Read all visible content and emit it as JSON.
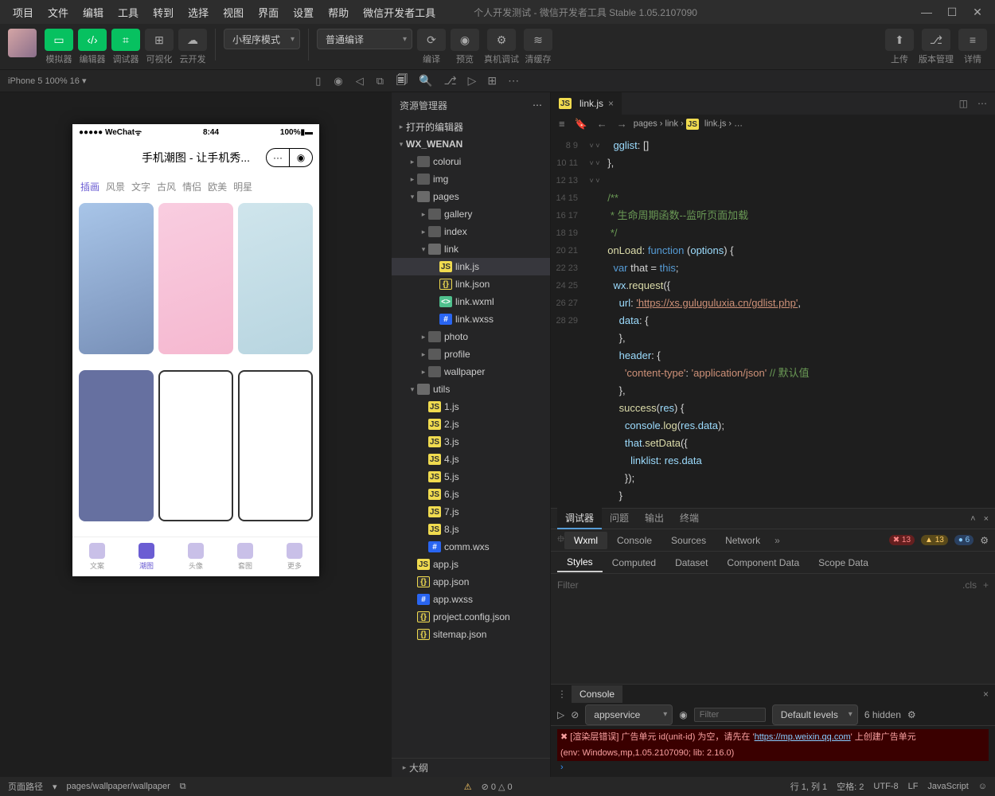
{
  "menu": [
    "项目",
    "文件",
    "编辑",
    "工具",
    "转到",
    "选择",
    "视图",
    "界面",
    "设置",
    "帮助",
    "微信开发者工具"
  ],
  "title": "个人开发测试 - 微信开发者工具 Stable 1.05.2107090",
  "toolbar": {
    "sim": "模拟器",
    "editor": "编辑器",
    "debugger": "调试器",
    "vis": "可视化",
    "cloud": "云开发",
    "mode": "小程序模式",
    "compile_mode": "普通编译",
    "compile": "编译",
    "preview": "预览",
    "remote": "真机调试",
    "clear": "清缓存",
    "upload": "上传",
    "version": "版本管理",
    "detail": "详情"
  },
  "sim": {
    "device": "iPhone 5 100% 16",
    "device_suffix": "▾"
  },
  "phone": {
    "carrier": "●●●●● WeChat",
    "wifi": "⌃",
    "time": "8:44",
    "battery": "100%",
    "title": "手机潮图 - 让手机秀...",
    "tabs": [
      "插画",
      "风景",
      "文字",
      "古风",
      "情侣",
      "欧美",
      "明星"
    ],
    "tabbar": [
      "文案",
      "潮图",
      "头像",
      "套图",
      "更多"
    ]
  },
  "explorer": {
    "title": "资源管理器",
    "sections": {
      "open_editors": "打开的编辑器",
      "project": "WX_WENAN",
      "outline": "大纲"
    },
    "tree": [
      {
        "d": 1,
        "t": "folder",
        "n": "colorui"
      },
      {
        "d": 1,
        "t": "folder-img",
        "n": "img"
      },
      {
        "d": 1,
        "t": "folder-open",
        "n": "pages",
        "open": true
      },
      {
        "d": 2,
        "t": "folder",
        "n": "gallery"
      },
      {
        "d": 2,
        "t": "folder",
        "n": "index"
      },
      {
        "d": 2,
        "t": "folder-open",
        "n": "link",
        "open": true
      },
      {
        "d": 3,
        "t": "js",
        "n": "link.js",
        "sel": true
      },
      {
        "d": 3,
        "t": "json",
        "n": "link.json"
      },
      {
        "d": 3,
        "t": "wxml",
        "n": "link.wxml"
      },
      {
        "d": 3,
        "t": "wxss",
        "n": "link.wxss"
      },
      {
        "d": 2,
        "t": "folder",
        "n": "photo"
      },
      {
        "d": 2,
        "t": "folder",
        "n": "profile"
      },
      {
        "d": 2,
        "t": "folder",
        "n": "wallpaper"
      },
      {
        "d": 1,
        "t": "folder-open",
        "n": "utils",
        "open": true
      },
      {
        "d": 2,
        "t": "js",
        "n": "1.js"
      },
      {
        "d": 2,
        "t": "js",
        "n": "2.js"
      },
      {
        "d": 2,
        "t": "js",
        "n": "3.js"
      },
      {
        "d": 2,
        "t": "js",
        "n": "4.js"
      },
      {
        "d": 2,
        "t": "js",
        "n": "5.js"
      },
      {
        "d": 2,
        "t": "js",
        "n": "6.js"
      },
      {
        "d": 2,
        "t": "js",
        "n": "7.js"
      },
      {
        "d": 2,
        "t": "js",
        "n": "8.js"
      },
      {
        "d": 2,
        "t": "wxss",
        "n": "comm.wxs"
      },
      {
        "d": 1,
        "t": "js",
        "n": "app.js"
      },
      {
        "d": 1,
        "t": "json",
        "n": "app.json"
      },
      {
        "d": 1,
        "t": "wxss",
        "n": "app.wxss"
      },
      {
        "d": 1,
        "t": "json",
        "n": "project.config.json"
      },
      {
        "d": 1,
        "t": "json",
        "n": "sitemap.json"
      }
    ]
  },
  "tab": {
    "name": "link.js",
    "breadcrumb": [
      "pages",
      "link",
      "link.js",
      "…"
    ]
  },
  "code": {
    "start": 8,
    "lines": [
      [
        [
          "prop",
          "    gglist"
        ],
        [
          "punc",
          ": []"
        ]
      ],
      [
        [
          "punc",
          "  },"
        ]
      ],
      [
        [
          "",
          ""
        ]
      ],
      [
        [
          "cmt",
          "  /**"
        ]
      ],
      [
        [
          "cmt",
          "   * 生命周期函数--监听页面加载"
        ]
      ],
      [
        [
          "cmt",
          "   */"
        ]
      ],
      [
        [
          "fn",
          "  onLoad"
        ],
        [
          "punc",
          ": "
        ],
        [
          "kw",
          "function"
        ],
        [
          "punc",
          " ("
        ],
        [
          "prop",
          "options"
        ],
        [
          "punc",
          ") {"
        ]
      ],
      [
        [
          "kw",
          "    var"
        ],
        [
          "punc",
          " that = "
        ],
        [
          "this",
          "this"
        ],
        [
          "punc",
          ";"
        ]
      ],
      [
        [
          "prop",
          "    wx"
        ],
        [
          "punc",
          "."
        ],
        [
          "fn",
          "request"
        ],
        [
          "punc",
          "({"
        ]
      ],
      [
        [
          "prop",
          "      url"
        ],
        [
          "punc",
          ": "
        ],
        [
          "str",
          "'https://xs.guluguluxia.cn/gdlist.php'"
        ],
        [
          "punc",
          ","
        ]
      ],
      [
        [
          "prop",
          "      data"
        ],
        [
          "punc",
          ": {"
        ]
      ],
      [
        [
          "punc",
          "      },"
        ]
      ],
      [
        [
          "prop",
          "      header"
        ],
        [
          "punc",
          ": {"
        ]
      ],
      [
        [
          "str",
          "        'content-type'"
        ],
        [
          "punc",
          ": "
        ],
        [
          "str",
          "'application/json'"
        ],
        [
          "cmt",
          " // 默认值"
        ]
      ],
      [
        [
          "punc",
          "      },"
        ]
      ],
      [
        [
          "fn",
          "      success"
        ],
        [
          "punc",
          "("
        ],
        [
          "prop",
          "res"
        ],
        [
          "punc",
          ") {"
        ]
      ],
      [
        [
          "prop",
          "        console"
        ],
        [
          "punc",
          "."
        ],
        [
          "fn",
          "log"
        ],
        [
          "punc",
          "("
        ],
        [
          "prop",
          "res"
        ],
        [
          "punc",
          "."
        ],
        [
          "prop",
          "data"
        ],
        [
          "punc",
          ");"
        ]
      ],
      [
        [
          "prop",
          "        that"
        ],
        [
          "punc",
          "."
        ],
        [
          "fn",
          "setData"
        ],
        [
          "punc",
          "({"
        ]
      ],
      [
        [
          "prop",
          "          linklist"
        ],
        [
          "punc",
          ": "
        ],
        [
          "prop",
          "res"
        ],
        [
          "punc",
          "."
        ],
        [
          "prop",
          "data"
        ]
      ],
      [
        [
          "punc",
          "        });"
        ]
      ],
      [
        [
          "punc",
          "      }"
        ]
      ],
      [
        [
          "punc",
          "    })"
        ]
      ]
    ],
    "folds": {
      "4": "˅",
      "7": "˅",
      "9": "˅",
      "13": "˅",
      "16": "˅",
      "18": "˅"
    }
  },
  "devtools": {
    "top_tabs": [
      "调试器",
      "问题",
      "输出",
      "终端"
    ],
    "tabs": [
      "Wxml",
      "Console",
      "Sources",
      "Network"
    ],
    "badges": {
      "err": "13",
      "warn": "13",
      "info": "6"
    },
    "styles_tabs": [
      "Styles",
      "Computed",
      "Dataset",
      "Component Data",
      "Scope Data"
    ],
    "filter_ph": "Filter",
    "cls": ".cls",
    "console": {
      "label": "Console",
      "scope": "appservice",
      "filter_ph": "Filter",
      "levels": "Default levels",
      "hidden": "6 hidden",
      "err1": "[渲染层错误] 广告单元 id(unit-id) 为空，请先在 '",
      "err_url": "https://mp.weixin.qq.com",
      "err1b": "' 上创建广告单元",
      "err2": "(env: Windows,mp,1.05.2107090; lib: 2.16.0)"
    }
  },
  "status": {
    "path_label": "页面路径",
    "path": "pages/wallpaper/wallpaper",
    "diag": "⊘ 0 △ 0",
    "line": "行 1, 列 1",
    "spaces": "空格: 2",
    "enc": "UTF-8",
    "eol": "LF",
    "lang": "JavaScript"
  }
}
